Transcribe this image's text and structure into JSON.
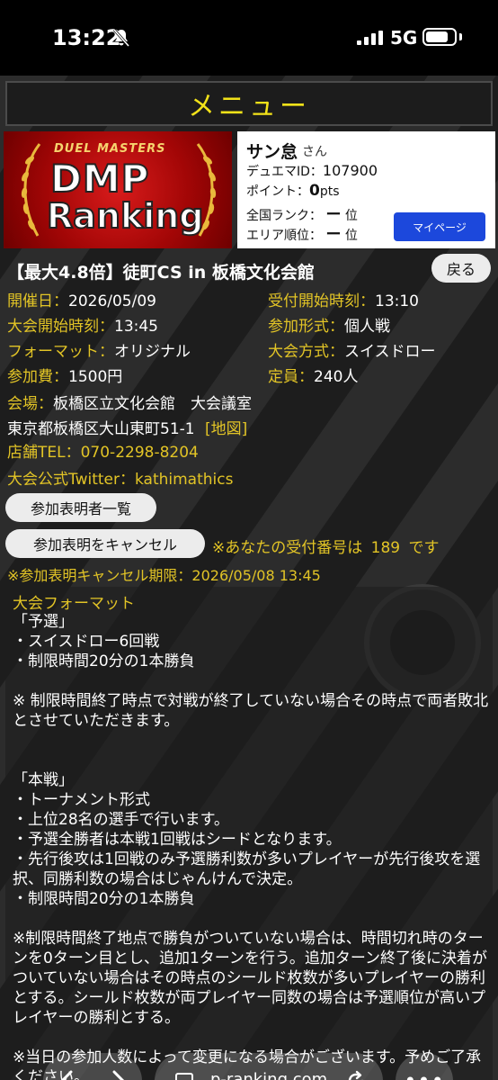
{
  "status_bar": {
    "time": "13:22",
    "network": "5G",
    "battery_level": 0.8
  },
  "menu": {
    "title": "メニュー"
  },
  "banner": {
    "brand_small": "DUEL MASTERS",
    "logo_dmp": "DMP",
    "logo_ranking": "Ranking"
  },
  "user": {
    "name": "サン怠",
    "honorific": "さん",
    "id_label": "デュエマID：",
    "id_value": "107900",
    "points_label": "ポイント：",
    "points_value": "0",
    "points_unit": "pts",
    "national_rank_label": "全国ランク：",
    "national_rank_value": "ー",
    "national_rank_unit": "位",
    "area_rank_label": "エリア順位：",
    "area_rank_value": "ー",
    "area_rank_unit": "位",
    "mypage_button": "マイページ"
  },
  "event": {
    "title": "【最大4.8倍】徒町CS in 板橋文化会館",
    "back_button": "戻る",
    "date_label": "開催日",
    "date_value": "2026/05/09",
    "reception_label": "受付開始時刻",
    "reception_value": "13:10",
    "start_label": "大会開始時刻",
    "start_value": "13:45",
    "entry_type_label": "参加形式",
    "entry_type_value": "個人戦",
    "format_label": "フォーマット",
    "format_value": "オリジナル",
    "system_label": "大会方式",
    "system_value": "スイスドロー",
    "fee_label": "参加費",
    "fee_value": "1500円",
    "capacity_label": "定員",
    "capacity_value": "240人",
    "venue_label": "会場",
    "venue_value": "板橋区立文化会館　大会議室",
    "address": "東京都板橋区大山東町51-1",
    "map_link": "[地図]",
    "shop_tel_label": "店舗TEL",
    "shop_tel_value": "070-2298-8204",
    "twitter_label": "大会公式Twitter",
    "twitter_value": "kathimathics",
    "participants_button": "参加表明者一覧",
    "cancel_button": "参加表明をキャンセル",
    "receipt_note_prefix": "※あなたの受付番号は",
    "receipt_number": "189",
    "receipt_note_suffix": "です",
    "cancel_deadline": "※参加表明キャンセル期限：2026/05/08 13:45"
  },
  "format_section": {
    "title": "大会フォーマット",
    "body": "「予選」\n・スイスドロー6回戦\n・制限時間20分の1本勝負\n\n※ 制限時間終了時点で対戦が終了していない場合その時点で両者敗北とさせていただきます。\n\n\n「本戦」\n・トーナメント形式\n・上位28名の選手で行います。\n・予選全勝者は本戦1回戦はシードとなります。\n・先行後攻は1回戦のみ予選勝利数が多いプレイヤーが先行後攻を選択、同勝利数の場合はじゃんけんで決定。\n・制限時間20分の1本勝負\n\n※制限時間終了地点で勝負がついていない場合は、時間切れ時のターンを0ターン目とし、追加1ターンを行う。追加ターン終了後に決着がついていない場合はその時点のシールド枚数が多いプレイヤーの勝利とする。シールド枚数が両プレイヤー同数の場合は予選順位が高いプレイヤーの勝利とする。\n\n※当日の参加人数によって変更になる場合がございます。予めご了承ください。"
  },
  "browser": {
    "url": "p-ranking.com"
  }
}
